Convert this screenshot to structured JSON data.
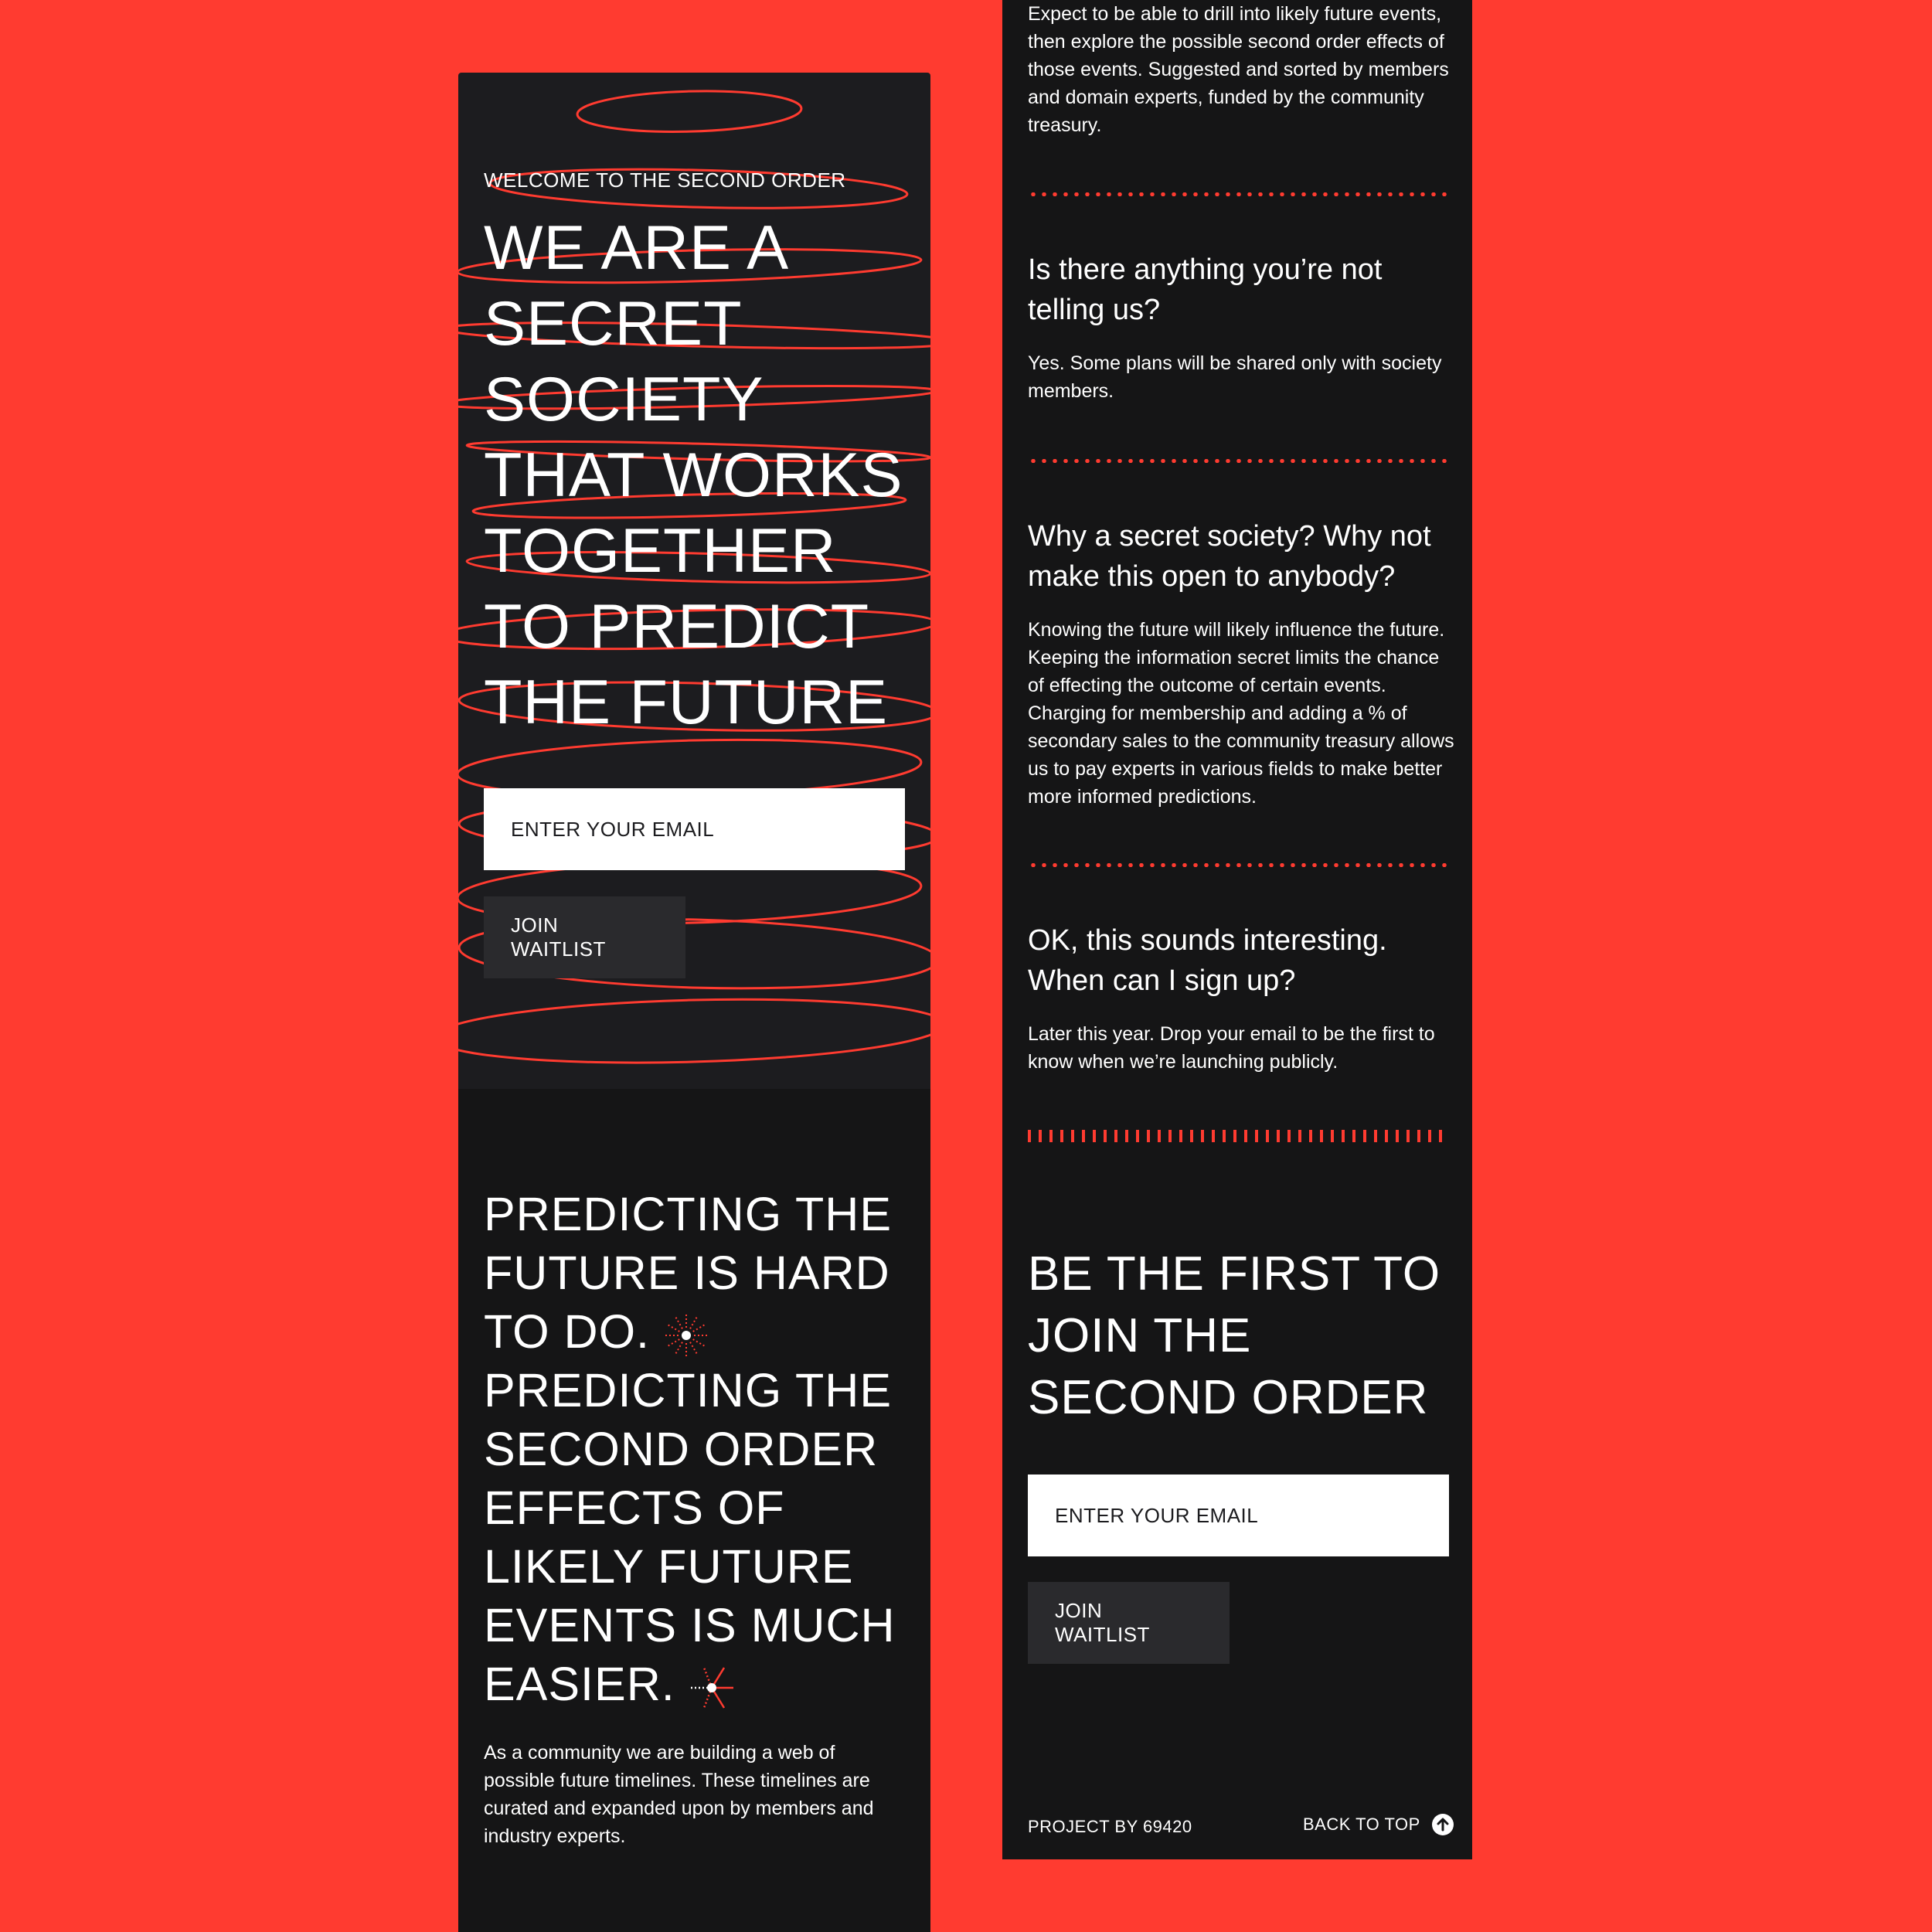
{
  "hero": {
    "eyebrow": "WELCOME TO THE SECOND ORDER",
    "headline": "WE ARE A SECRET SOCIETY THAT WORKS TOGETHER TO PREDICT THE FUTURE",
    "email_placeholder": "ENTER YOUR EMAIL",
    "join_label": "JOIN WAITLIST"
  },
  "intro": {
    "headline_part1": "PREDICTING THE FUTURE IS HARD TO DO.",
    "headline_part2": "PREDICTING THE SECOND ORDER EFFECTS OF LIKELY FUTURE EVENTS IS MUCH EASIER.",
    "body": "As a community we are building a web of possible future timelines. These timelines are curated and expanded upon by members and industry experts."
  },
  "faq": {
    "intro": "Expect to be able to drill into likely future events, then explore the possible second order effects of those events. Suggested and sorted by members and domain experts, funded by the community treasury.",
    "items": [
      {
        "question": "Is there anything you’re not telling us?",
        "answer": "Yes. Some plans will be shared only with society members."
      },
      {
        "question": "Why a secret society? Why not make this open to anybody?",
        "answer": "Knowing the future will likely influence the future. Keeping the information secret limits the chance of effecting the outcome of certain events. Charging for membership and adding a % of secondary sales to the community treasury allows us to pay experts in various fields to make better more informed predictions."
      },
      {
        "question": "OK, this sounds interesting. When can I sign up?",
        "answer": "Later this year. Drop your email to be the first to know when we’re launching publicly."
      }
    ]
  },
  "cta": {
    "title": "BE THE FIRST TO JOIN THE SECOND ORDER",
    "email_placeholder": "ENTER YOUR EMAIL",
    "join_label": "JOIN WAITLIST"
  },
  "footer": {
    "credit": "PROJECT BY 69420",
    "back_to_top": "BACK TO TOP"
  },
  "colors": {
    "background": "#ff3b30",
    "panel": "#151516",
    "hero_panel": "#1c1c1f",
    "accent": "#ff3b30",
    "button": "#2a2a2d"
  },
  "icons": [
    "rings-illustration",
    "spark-icon",
    "spark-arrow-icon",
    "arrow-up-circle-icon"
  ]
}
